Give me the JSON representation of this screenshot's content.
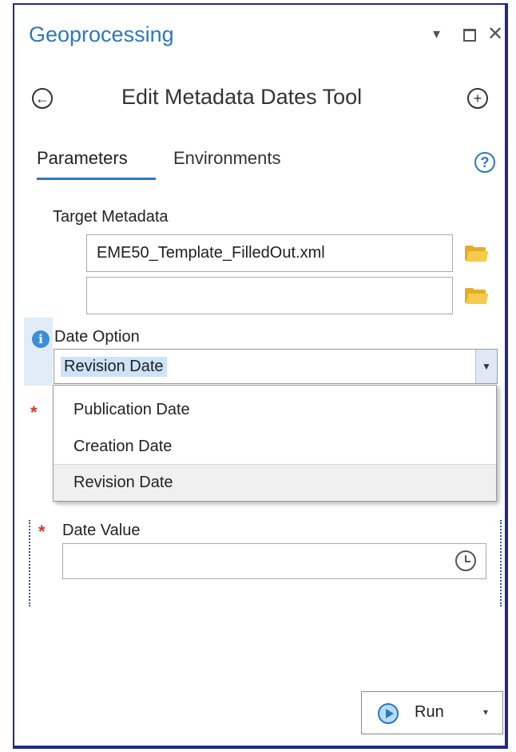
{
  "pane": {
    "title": "Geoprocessing"
  },
  "window_controls": {
    "dropdown_icon": "▾",
    "maximize_icon": "",
    "close_icon": "✕"
  },
  "tool": {
    "title": "Edit Metadata Dates Tool",
    "back_icon": "←",
    "add_icon": "+"
  },
  "tabs": [
    {
      "label": "Parameters",
      "active": true
    },
    {
      "label": "Environments",
      "active": false
    }
  ],
  "help_icon": "?",
  "parameters": {
    "target_metadata": {
      "label": "Target Metadata",
      "values": [
        "EME50_Template_FilledOut.xml",
        ""
      ]
    },
    "date_option": {
      "label": "Date Option",
      "info_icon": "i",
      "selected": "Revision Date",
      "arrow": "▼",
      "options": [
        "Publication Date",
        "Creation Date",
        "Revision Date"
      ]
    },
    "required_marker": "*",
    "date_value": {
      "label": "Date Value",
      "value": ""
    }
  },
  "run_button": {
    "label": "Run",
    "caret": "▾"
  },
  "colors": {
    "accent": "#2b78c2",
    "required": "#d03a2e",
    "frame": "#1f2a8a",
    "folder": "#e3ad28"
  }
}
